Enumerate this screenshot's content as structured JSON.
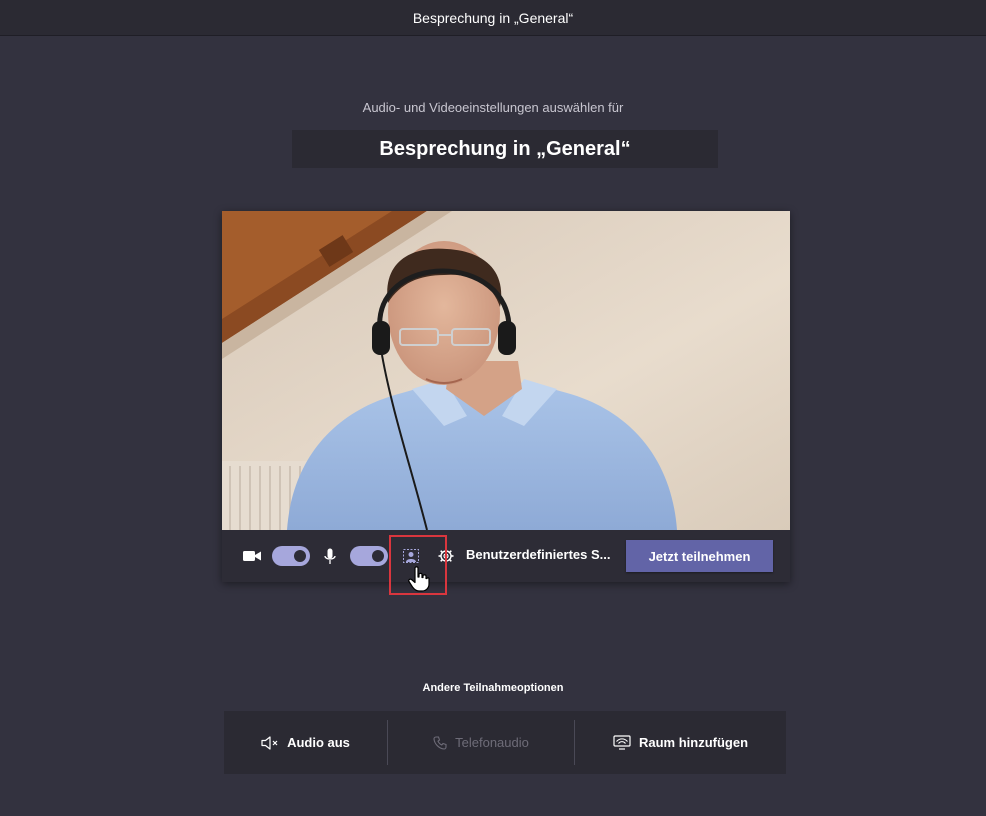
{
  "window": {
    "title": "Besprechung in „General“"
  },
  "prejoin": {
    "subtitle": "Audio- und Videoeinstellungen auswählen für",
    "meeting_name": "Besprechung in „General“"
  },
  "controls": {
    "camera": {
      "icon": "video-camera-icon",
      "toggle_on": true
    },
    "microphone": {
      "icon": "microphone-icon",
      "toggle_on": true
    },
    "background_effects": {
      "icon": "background-effects-icon",
      "highlighted": true
    },
    "device_settings": {
      "icon": "gear-icon",
      "label": "Benutzerdefiniertes S..."
    },
    "join_label": "Jetzt teilnehmen"
  },
  "other_options": {
    "title": "Andere Teilnahmeoptionen",
    "items": [
      {
        "label": "Audio aus",
        "icon": "speaker-muted-icon",
        "enabled": true
      },
      {
        "label": "Telefonaudio",
        "icon": "phone-icon",
        "enabled": false
      },
      {
        "label": "Raum hinzufügen",
        "icon": "room-cast-icon",
        "enabled": true
      }
    ]
  },
  "colors": {
    "background": "#33323f",
    "accent": "#6264a7",
    "toggle": "#a6a7dc",
    "highlight": "#d9363e"
  }
}
